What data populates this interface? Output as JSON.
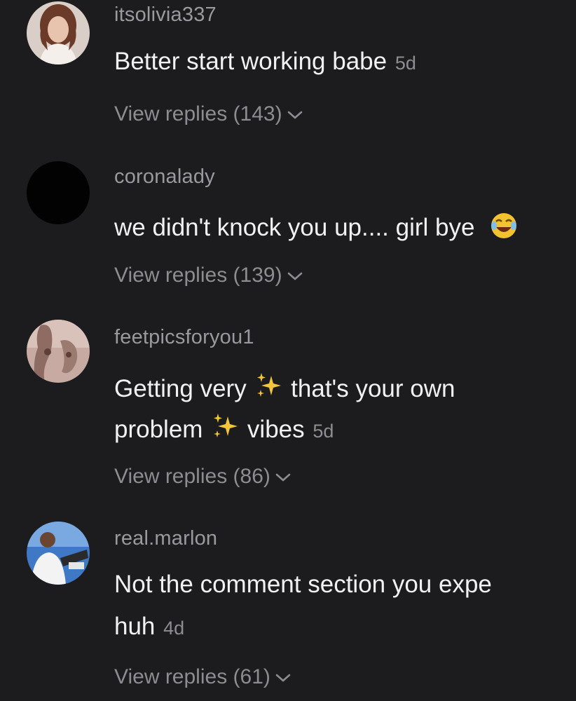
{
  "colors": {
    "background": "#1c1b1e",
    "username": "#9a999d",
    "comment_text": "#f1f0f2",
    "muted": "#8d8c90"
  },
  "comments": [
    {
      "username": "itsolivia337",
      "text_lines": [
        "Better start working babe"
      ],
      "time": "5d",
      "replies": "View replies (143)",
      "avatar_icon": "profile-photo-woman"
    },
    {
      "username": "coronalady",
      "text_lines": [
        "we didn't knock you up.... girl bye"
      ],
      "emoji": "laughing-emoji",
      "replies": "View replies (139)",
      "avatar_icon": "profile-photo-black"
    },
    {
      "username": "feetpicsforyou1",
      "text_lines": [
        "Getting very",
        "that's your own",
        "problem",
        "vibes"
      ],
      "emoji": "sparkles-emoji",
      "time": "5d",
      "replies": "View replies (86)",
      "avatar_icon": "profile-photo-feet"
    },
    {
      "username": "real.marlon",
      "text_lines": [
        "Not the comment section you expe",
        "huh"
      ],
      "time": "4d",
      "replies": "View replies (61)",
      "avatar_icon": "profile-photo-man"
    }
  ]
}
